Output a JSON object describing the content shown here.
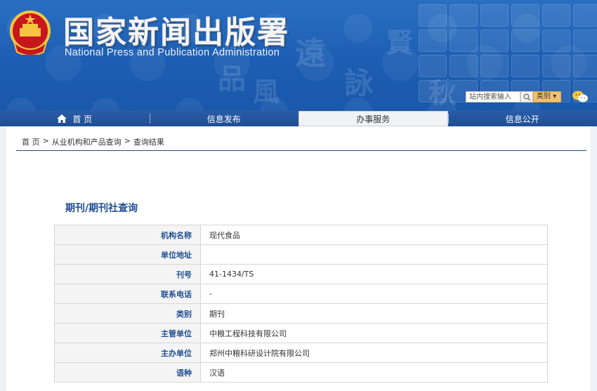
{
  "header": {
    "title": "国家新闻出版署",
    "subtitle": "National Press and Publication Administration",
    "search_placeholder": "站内搜索输入",
    "category_label": "类别"
  },
  "nav": [
    {
      "label": "首 页",
      "icon": "home-icon"
    },
    {
      "label": "信息发布"
    },
    {
      "label": "办事服务",
      "active": true
    },
    {
      "label": "信息公开"
    }
  ],
  "breadcrumb": [
    "首 页",
    "从业机构和产品查询",
    "查询结果"
  ],
  "section_title": "期刊/期刊社查询",
  "rows": [
    {
      "key": "机构名称",
      "value": "现代食品"
    },
    {
      "key": "单位地址",
      "value": ""
    },
    {
      "key": "刊号",
      "value": "41-1434/TS"
    },
    {
      "key": "联系电话",
      "value": "-"
    },
    {
      "key": "类别",
      "value": "期刊"
    },
    {
      "key": "主管单位",
      "value": "中粮工程科技有限公司"
    },
    {
      "key": "主办单位",
      "value": "郑州中粮科研设计院有限公司"
    },
    {
      "key": "语种",
      "value": "汉语"
    }
  ],
  "colors": {
    "primary": "#1f4e93",
    "header": "#1c5eb3",
    "category_button": "#f3c16c"
  }
}
